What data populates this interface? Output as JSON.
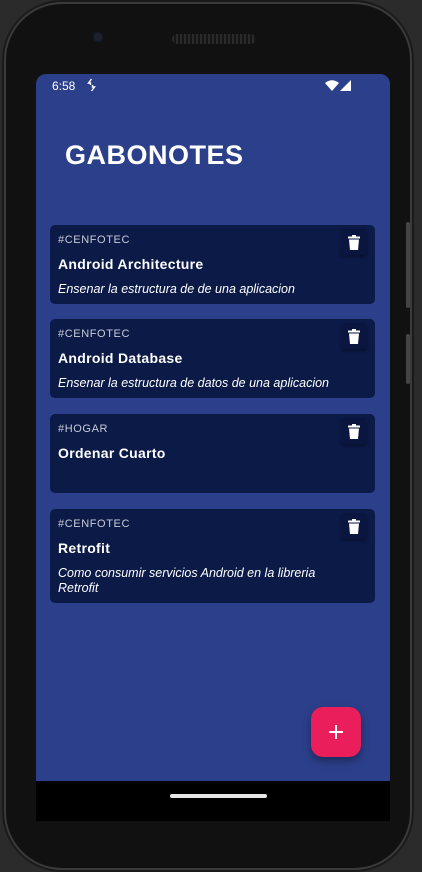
{
  "status_bar": {
    "time": "6:58",
    "icons": [
      "data-sync-icon",
      "wifi-icon",
      "signal-icon"
    ]
  },
  "app": {
    "title": "GABONOTES"
  },
  "notes": [
    {
      "tag": "#CENFOTEC",
      "title": "Android Architecture",
      "description": "Ensenar la estructura de de una aplicacion"
    },
    {
      "tag": "#CENFOTEC",
      "title": "Android Database",
      "description": "Ensenar la estructura de datos de una aplicacion"
    },
    {
      "tag": "#HOGAR",
      "title": "Ordenar Cuarto",
      "description": ""
    },
    {
      "tag": "#CENFOTEC",
      "title": "Retrofit",
      "description": "Como consumir servicios Android en la libreria Retrofit"
    }
  ],
  "fab": {
    "icon": "plus-icon",
    "label": "+"
  },
  "colors": {
    "background": "#2c3f8a",
    "card": "#0c1a48",
    "fab": "#e91e5a",
    "text": "#ffffff"
  }
}
